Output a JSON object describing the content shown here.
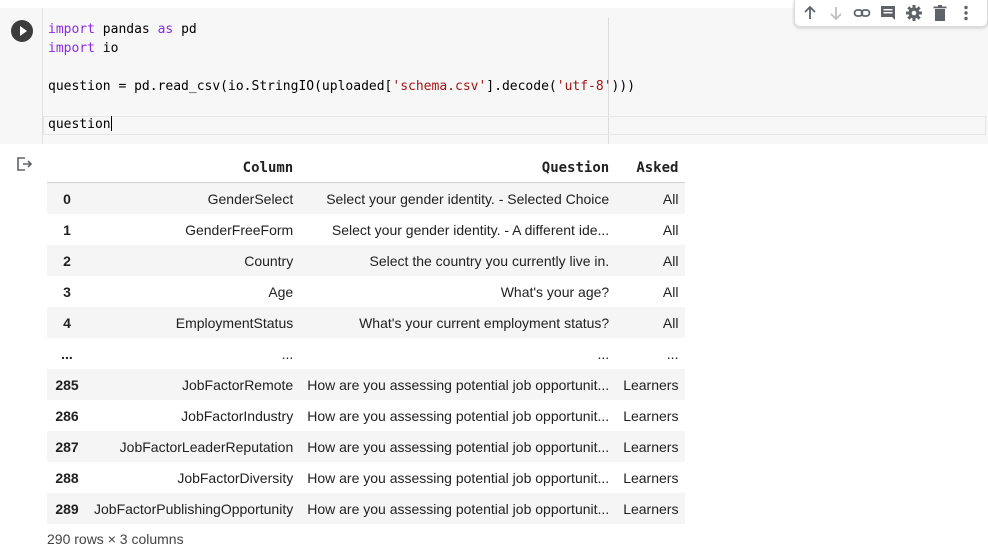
{
  "code_cell": {
    "lines": [
      [
        {
          "t": "import",
          "c": "kw"
        },
        {
          "t": " pandas ",
          "c": ""
        },
        {
          "t": "as",
          "c": "kw"
        },
        {
          "t": " pd",
          "c": ""
        }
      ],
      [
        {
          "t": "import",
          "c": "kw"
        },
        {
          "t": " io",
          "c": ""
        }
      ],
      [],
      [
        {
          "t": "question = pd.read_csv(io.StringIO(uploaded[",
          "c": ""
        },
        {
          "t": "'schema.csv'",
          "c": "str"
        },
        {
          "t": "].decode(",
          "c": ""
        },
        {
          "t": "'utf-8'",
          "c": "str"
        },
        {
          "t": ")))",
          "c": ""
        }
      ],
      [],
      [
        {
          "t": "question",
          "c": ""
        }
      ]
    ]
  },
  "toolbar": {
    "icons": [
      "arrow-up-icon",
      "arrow-down-icon",
      "link-icon",
      "comment-icon",
      "gear-icon",
      "trash-icon",
      "more-vert-icon"
    ]
  },
  "dataframe": {
    "columns": [
      "",
      "Column",
      "Question",
      "Asked"
    ],
    "rows": [
      [
        "0",
        "GenderSelect",
        "Select your gender identity. - Selected Choice",
        "All"
      ],
      [
        "1",
        "GenderFreeForm",
        "Select your gender identity. - A different ide...",
        "All"
      ],
      [
        "2",
        "Country",
        "Select the country you currently live in.",
        "All"
      ],
      [
        "3",
        "Age",
        "What's your age?",
        "All"
      ],
      [
        "4",
        "EmploymentStatus",
        "What's your current employment status?",
        "All"
      ],
      [
        "...",
        "...",
        "...",
        "..."
      ],
      [
        "285",
        "JobFactorRemote",
        "How are you assessing potential job opportunit...",
        "Learners"
      ],
      [
        "286",
        "JobFactorIndustry",
        "How are you assessing potential job opportunit...",
        "Learners"
      ],
      [
        "287",
        "JobFactorLeaderReputation",
        "How are you assessing potential job opportunit...",
        "Learners"
      ],
      [
        "288",
        "JobFactorDiversity",
        "How are you assessing potential job opportunit...",
        "Learners"
      ],
      [
        "289",
        "JobFactorPublishingOpportunity",
        "How are you assessing potential job opportunit...",
        "Learners"
      ]
    ],
    "shape_text": "290 rows × 3 columns"
  }
}
